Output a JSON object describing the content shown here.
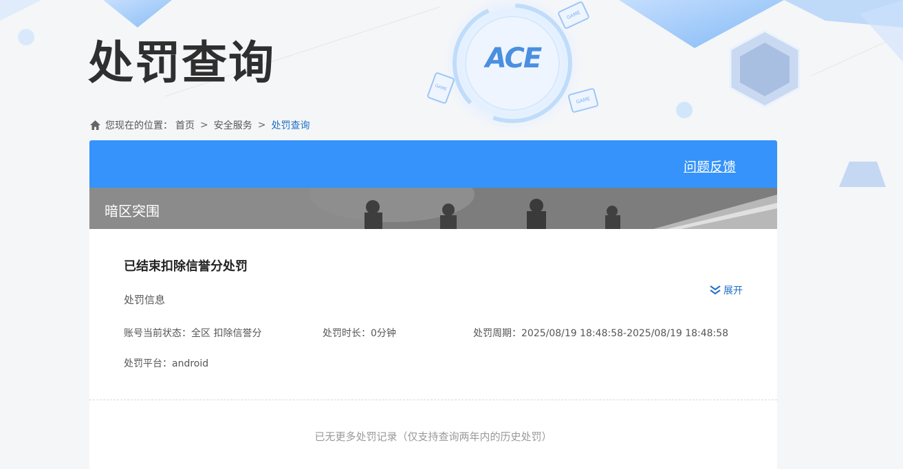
{
  "page": {
    "title": "处罚查询"
  },
  "decor": {
    "logo_text": "ACE",
    "badge_text": "GAME"
  },
  "breadcrumb": {
    "prefix": "您现在的位置：",
    "items": [
      "首页",
      "安全服务"
    ],
    "current": "处罚查询",
    "separator": ">"
  },
  "panel": {
    "feedback_label": "问题反馈",
    "game_name": "暗区突围"
  },
  "record": {
    "title": "已结束扣除信誉分处罚",
    "section_label": "处罚信息",
    "status": "账号当前状态：全区 扣除信誉分",
    "duration": "处罚时长：0分钟",
    "period": "处罚周期：2025/08/19 18:48:58-2025/08/19 18:48:58",
    "platform": "处罚平台：android",
    "expand_label": "展开"
  },
  "footer": {
    "no_more": "已无更多处罚记录（仅支持查询两年内的历史处罚）"
  },
  "colors": {
    "accent": "#3593fb",
    "link": "#1e6fc5",
    "title": "#2f2f2f"
  }
}
